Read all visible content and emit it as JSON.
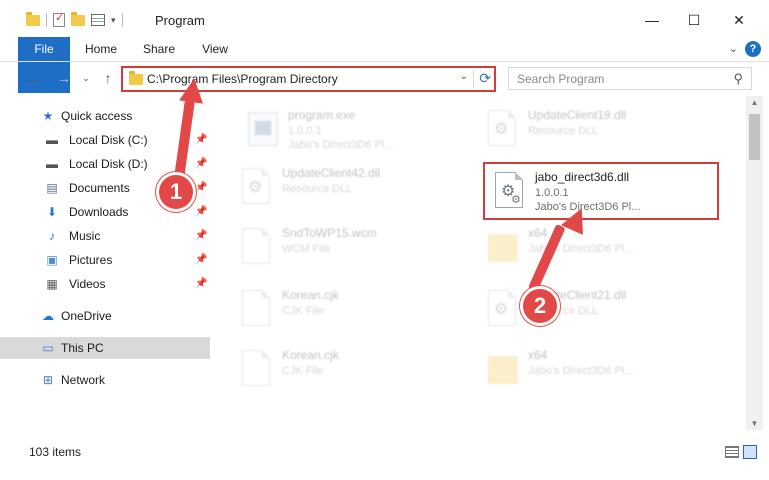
{
  "window": {
    "title": "Program",
    "controls": {
      "minimize": "—",
      "maximize": "☐",
      "close": "✕"
    }
  },
  "ribbon": {
    "tabs": [
      "File",
      "Home",
      "Share",
      "View"
    ],
    "help": "?"
  },
  "address": {
    "path": "C:\\Program Files\\Program Directory",
    "refresh_icon": "⟳"
  },
  "search": {
    "placeholder": "Search Program"
  },
  "nav": {
    "quick_access": "Quick access",
    "items": [
      {
        "label": "Local Disk (C:)",
        "icon": "drive-icon",
        "pinned": true
      },
      {
        "label": "Local Disk (D:)",
        "icon": "drive-icon",
        "pinned": true
      },
      {
        "label": "Documents",
        "icon": "documents-icon",
        "pinned": true
      },
      {
        "label": "Downloads",
        "icon": "downloads-icon",
        "pinned": true
      },
      {
        "label": "Music",
        "icon": "music-icon",
        "pinned": true
      },
      {
        "label": "Pictures",
        "icon": "pictures-icon",
        "pinned": true
      },
      {
        "label": "Videos",
        "icon": "videos-icon",
        "pinned": true
      }
    ],
    "onedrive": "OneDrive",
    "this_pc": "This PC",
    "network": "Network"
  },
  "files": [
    {
      "name": "program.exe",
      "line2": "1.0.0.1",
      "line3": "Jabo's Direct3D6 Pl...",
      "kind": "exe",
      "faded": true
    },
    {
      "name": "UpdateClient19.dll",
      "line2": "Resource DLL",
      "line3": "",
      "kind": "dll",
      "faded": true
    },
    {
      "name": "UpdateClient42.dll",
      "line2": "Resource DLL",
      "line3": "",
      "kind": "dll",
      "faded": true
    },
    {
      "name": "jabo_direct3d6.dll",
      "line2": "1.0.0.1",
      "line3": "Jabo's Direct3D6 Pl...",
      "kind": "dll",
      "faded": false
    },
    {
      "name": "SndToWP15.wcm",
      "line2": "WCM File",
      "line3": "",
      "kind": "doc",
      "faded": true
    },
    {
      "name": "x64",
      "line2": "Jabo's Direct3D6 Pl...",
      "line3": "",
      "kind": "folder",
      "faded": true
    },
    {
      "name": "Korean.cjk",
      "line2": "CJK File",
      "line3": "",
      "kind": "doc",
      "faded": true
    },
    {
      "name": "UpdateClient21.dll",
      "line2": "Resource DLL",
      "line3": "",
      "kind": "dll",
      "faded": true
    },
    {
      "name": "Korean.cjk",
      "line2": "CJK File",
      "line3": "",
      "kind": "doc",
      "faded": true
    },
    {
      "name": "x64",
      "line2": "Jabo's Direct3D6 Pl...",
      "line3": "",
      "kind": "folder",
      "faded": true
    }
  ],
  "status": {
    "item_count": "103 items"
  },
  "callouts": {
    "step1": "1",
    "step2": "2"
  },
  "colors": {
    "accent": "#1f6ec6",
    "highlight": "#d43c3c",
    "callout": "#e34848"
  }
}
